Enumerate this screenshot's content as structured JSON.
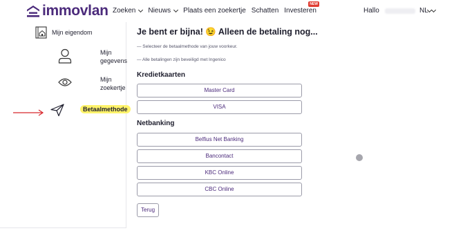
{
  "header": {
    "logo_text": "immovlan",
    "nav": [
      {
        "label": "Zoeken",
        "has_dropdown": true
      },
      {
        "label": "Nieuws",
        "has_dropdown": true
      },
      {
        "label": "Plaats een zoekertje",
        "has_dropdown": false
      },
      {
        "label": "Schatten",
        "has_dropdown": false
      },
      {
        "label": "Investeren",
        "has_dropdown": false,
        "badge": "NEW"
      }
    ],
    "greeting": "Hallo",
    "language": "NL"
  },
  "sidebar": {
    "items": [
      {
        "label": "Mijn eigendom",
        "icon": "property-icon"
      },
      {
        "label": "Mijn gegevens",
        "icon": "user-icon"
      },
      {
        "label": "Mijn zoekertje",
        "icon": "eye-icon"
      },
      {
        "label": "Betaalmethode",
        "icon": "send-icon",
        "active": true
      }
    ]
  },
  "main": {
    "title": "Je bent er bijna! 😉 Alleen de betaling nog...",
    "notes": [
      "— Selecteer de betaalmethode van jouw voorkeur.",
      "— Alle betalingen zijn beveiligd met Ingenico"
    ],
    "credit_cards": {
      "title": "Kredietkaarten",
      "buttons": [
        "Master Card",
        "VISA"
      ]
    },
    "netbanking": {
      "title": "Netbanking",
      "buttons": [
        "Belfius Net Banking",
        "Bancontact",
        "KBC Online",
        "CBC Online"
      ]
    },
    "back_label": "Terug"
  },
  "colors": {
    "brand": "#4b2a7b",
    "highlight": "#fff36a",
    "annotation_arrow": "#d8262b",
    "badge": "#e03c31"
  }
}
